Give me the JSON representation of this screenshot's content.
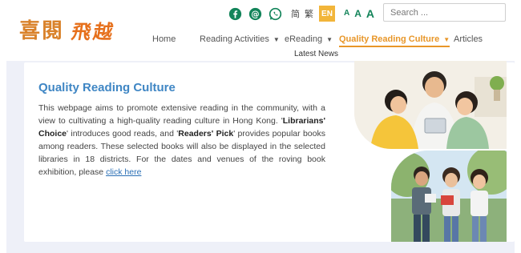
{
  "logo": {
    "part1": "喜閱",
    "part2": "飛越"
  },
  "toolbar": {
    "social": [
      "facebook-icon",
      "threads-icon",
      "whatsapp-icon"
    ],
    "lang_sc": "简",
    "lang_tc": "繁",
    "lang_en": "EN",
    "font_small": "A",
    "font_medium": "A",
    "font_large": "A"
  },
  "search": {
    "placeholder": "Search ..."
  },
  "nav": {
    "home": "Home",
    "reading_activities": "Reading Activities",
    "ereading": "eReading",
    "quality_reading_culture": "Quality Reading Culture",
    "articles": "Articles",
    "latest_news": "Latest News"
  },
  "main": {
    "title": "Quality Reading Culture",
    "p1": "This webpage aims to promote extensive reading in the community, with a view to cultivating a high-quality reading culture in Hong Kong. '",
    "librarians_choice": "Librarians' Choice",
    "p2": "' introduces good reads, and '",
    "readers_pick": "Readers' Pick",
    "p3": "' provides popular books among readers. These selected books will also be displayed in the selected libraries in 18 districts. For the dates and venues of the roving book exhibition, please ",
    "click_here": "click here"
  },
  "colors": {
    "accent": "#e89628",
    "title_blue": "#3f86c4",
    "fontsize_green": "#13845a",
    "content_bg": "#eef0f8"
  }
}
